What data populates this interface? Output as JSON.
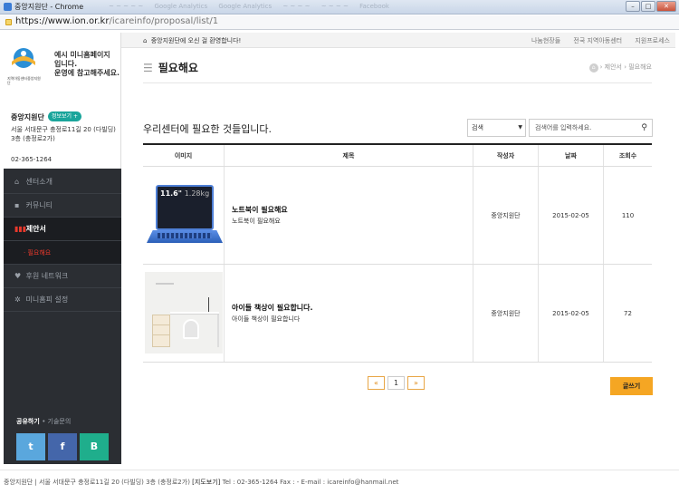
{
  "browser": {
    "window_title": "중앙지원단 - Chrome",
    "background_tabs": [
      "~ ~ ~ ~ ~",
      "Google Analytics",
      "Google Analytics",
      "~ ~ ~ ~",
      "~ ~ ~ ~",
      "Facebook"
    ],
    "url_host": "https://www.ion.or.kr",
    "url_path": "/icareinfo/proposal/list/1",
    "minimize": "–",
    "maximize": "□",
    "close": "✕"
  },
  "topbar": {
    "welcome": "중앙지원단에 오신 걸 환영합니다!",
    "links": [
      "나눔현장들",
      "전국 지역아동센터",
      "지원프로세스"
    ]
  },
  "sidebar": {
    "logo_caption": "지역아동센터중앙지원단",
    "notice": [
      "예시 미니홈페이지",
      "입니다.",
      "운영에 참고해주세요."
    ],
    "org_name": "중앙지원단",
    "map_button": "정보보기 +",
    "address": "서울 서대문구 충정로11길 20 (다빌딩) 3층 (충정로2가)",
    "tel": "02-365-1264",
    "menu": [
      {
        "icon": "home-icon",
        "glyph": "⌂",
        "label": "센터소개",
        "active": false
      },
      {
        "icon": "chat-icon",
        "glyph": "▪",
        "label": "커뮤니티",
        "active": false
      },
      {
        "icon": "bars-icon",
        "glyph": "▮▮▮",
        "label": "제안서",
        "active": true
      },
      {
        "icon": "heart-icon",
        "glyph": "♥",
        "label": "후원 네트워크",
        "active": false
      },
      {
        "icon": "gear-icon",
        "glyph": "✲",
        "label": "미니홈피 설정",
        "active": false
      }
    ],
    "submenu_label": "· 필요해요",
    "social_label": "공유하기",
    "faq_label": "• 기술문의",
    "social": {
      "twitter": "t",
      "facebook": "f",
      "blog": "B"
    }
  },
  "main": {
    "page_title": "필요해요",
    "breadcrumb_home": "⌂",
    "breadcrumb": "› 제안서 › 필요해요",
    "subhead": "우리센터에 필요한 것들입니다.",
    "search_select": "검색",
    "search_placeholder": "검색어를 입력하세요.",
    "table": {
      "headers": [
        "이미지",
        "제목",
        "작성자",
        "날짜",
        "조회수"
      ],
      "rows": [
        {
          "thumb_size": "11.6\"",
          "thumb_weight": "1.28kg",
          "title": "노트북이 필요해요",
          "desc": "노트북이 필요해요",
          "author": "중앙지원단",
          "date": "2015-02-05",
          "views": "110"
        },
        {
          "title": "아이들 책상이 필요합니다.",
          "desc": "아이들 책상이 필요합니다",
          "author": "중앙지원단",
          "date": "2015-02-05",
          "views": "72"
        }
      ]
    },
    "pager": {
      "prev": "«",
      "page": "1",
      "next": "»"
    },
    "write_button": "글쓰기"
  },
  "footer": {
    "text": "중앙지원단 | 서울 서대문구 충정로11길 20 (다빌딩) 3층 (충정로2가)",
    "map_link": "[지도보기]",
    "contact": "Tel : 02-365-1264  Fax : -  E-mail : icareinfo@hanmail.net"
  }
}
